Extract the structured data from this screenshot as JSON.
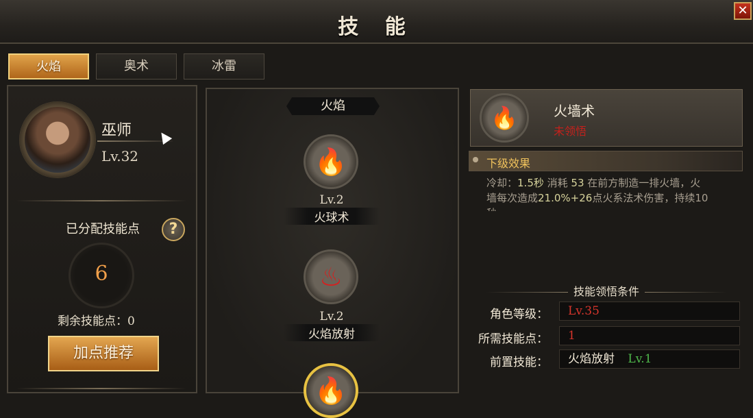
{
  "window": {
    "title": "技 能",
    "close_label": "✕"
  },
  "tabs": [
    {
      "label": "火焰",
      "active": true
    },
    {
      "label": "奥术",
      "active": false
    },
    {
      "label": "冰雷",
      "active": false
    }
  ],
  "character": {
    "name": "巫师",
    "level": "Lv.32"
  },
  "skill_points": {
    "allocated_label": "已分配技能点",
    "allocated_value": "6",
    "remaining_text": "剩余技能点：0",
    "help_label": "?",
    "recommend_button": "加点推荐"
  },
  "skill_tree": {
    "category": "火焰",
    "skills": [
      {
        "level": "Lv.2",
        "name": "火球术",
        "icon": "fireball-icon"
      },
      {
        "level": "Lv.2",
        "name": "火焰放射",
        "icon": "flame-spray-icon"
      },
      {
        "level": "",
        "name": "",
        "icon": "fire-wall-icon"
      }
    ]
  },
  "detail": {
    "name": "火墙术",
    "status": "未领悟",
    "icon": "fire-wall-icon",
    "next_level_title": "下级效果",
    "description_line1_a": "冷却：",
    "description_line1_b": "1.5秒",
    "description_line1_c": " 消耗 ",
    "description_line1_d": "53",
    "description_line1_e": " 在前方制造一排火墙，火",
    "description_line2_a": "墙每次造成",
    "description_line2_b": "21.0%+26",
    "description_line2_c": "点火系法术伤害，持续10",
    "description_line3": "秒"
  },
  "requirements": {
    "title": "技能领悟条件",
    "rows": [
      {
        "label": "角色等级：",
        "value": "Lv.35"
      },
      {
        "label": "所需技能点：",
        "value": "1"
      },
      {
        "label": "前置技能：",
        "value": "火焰放射",
        "value_extra": "Lv.1"
      }
    ]
  },
  "colors": {
    "accent_gold": "#e3a650",
    "fire_red": "#d81e1e",
    "requirement_unmet": "#d7352c",
    "requirement_met": "#4fb84b"
  }
}
